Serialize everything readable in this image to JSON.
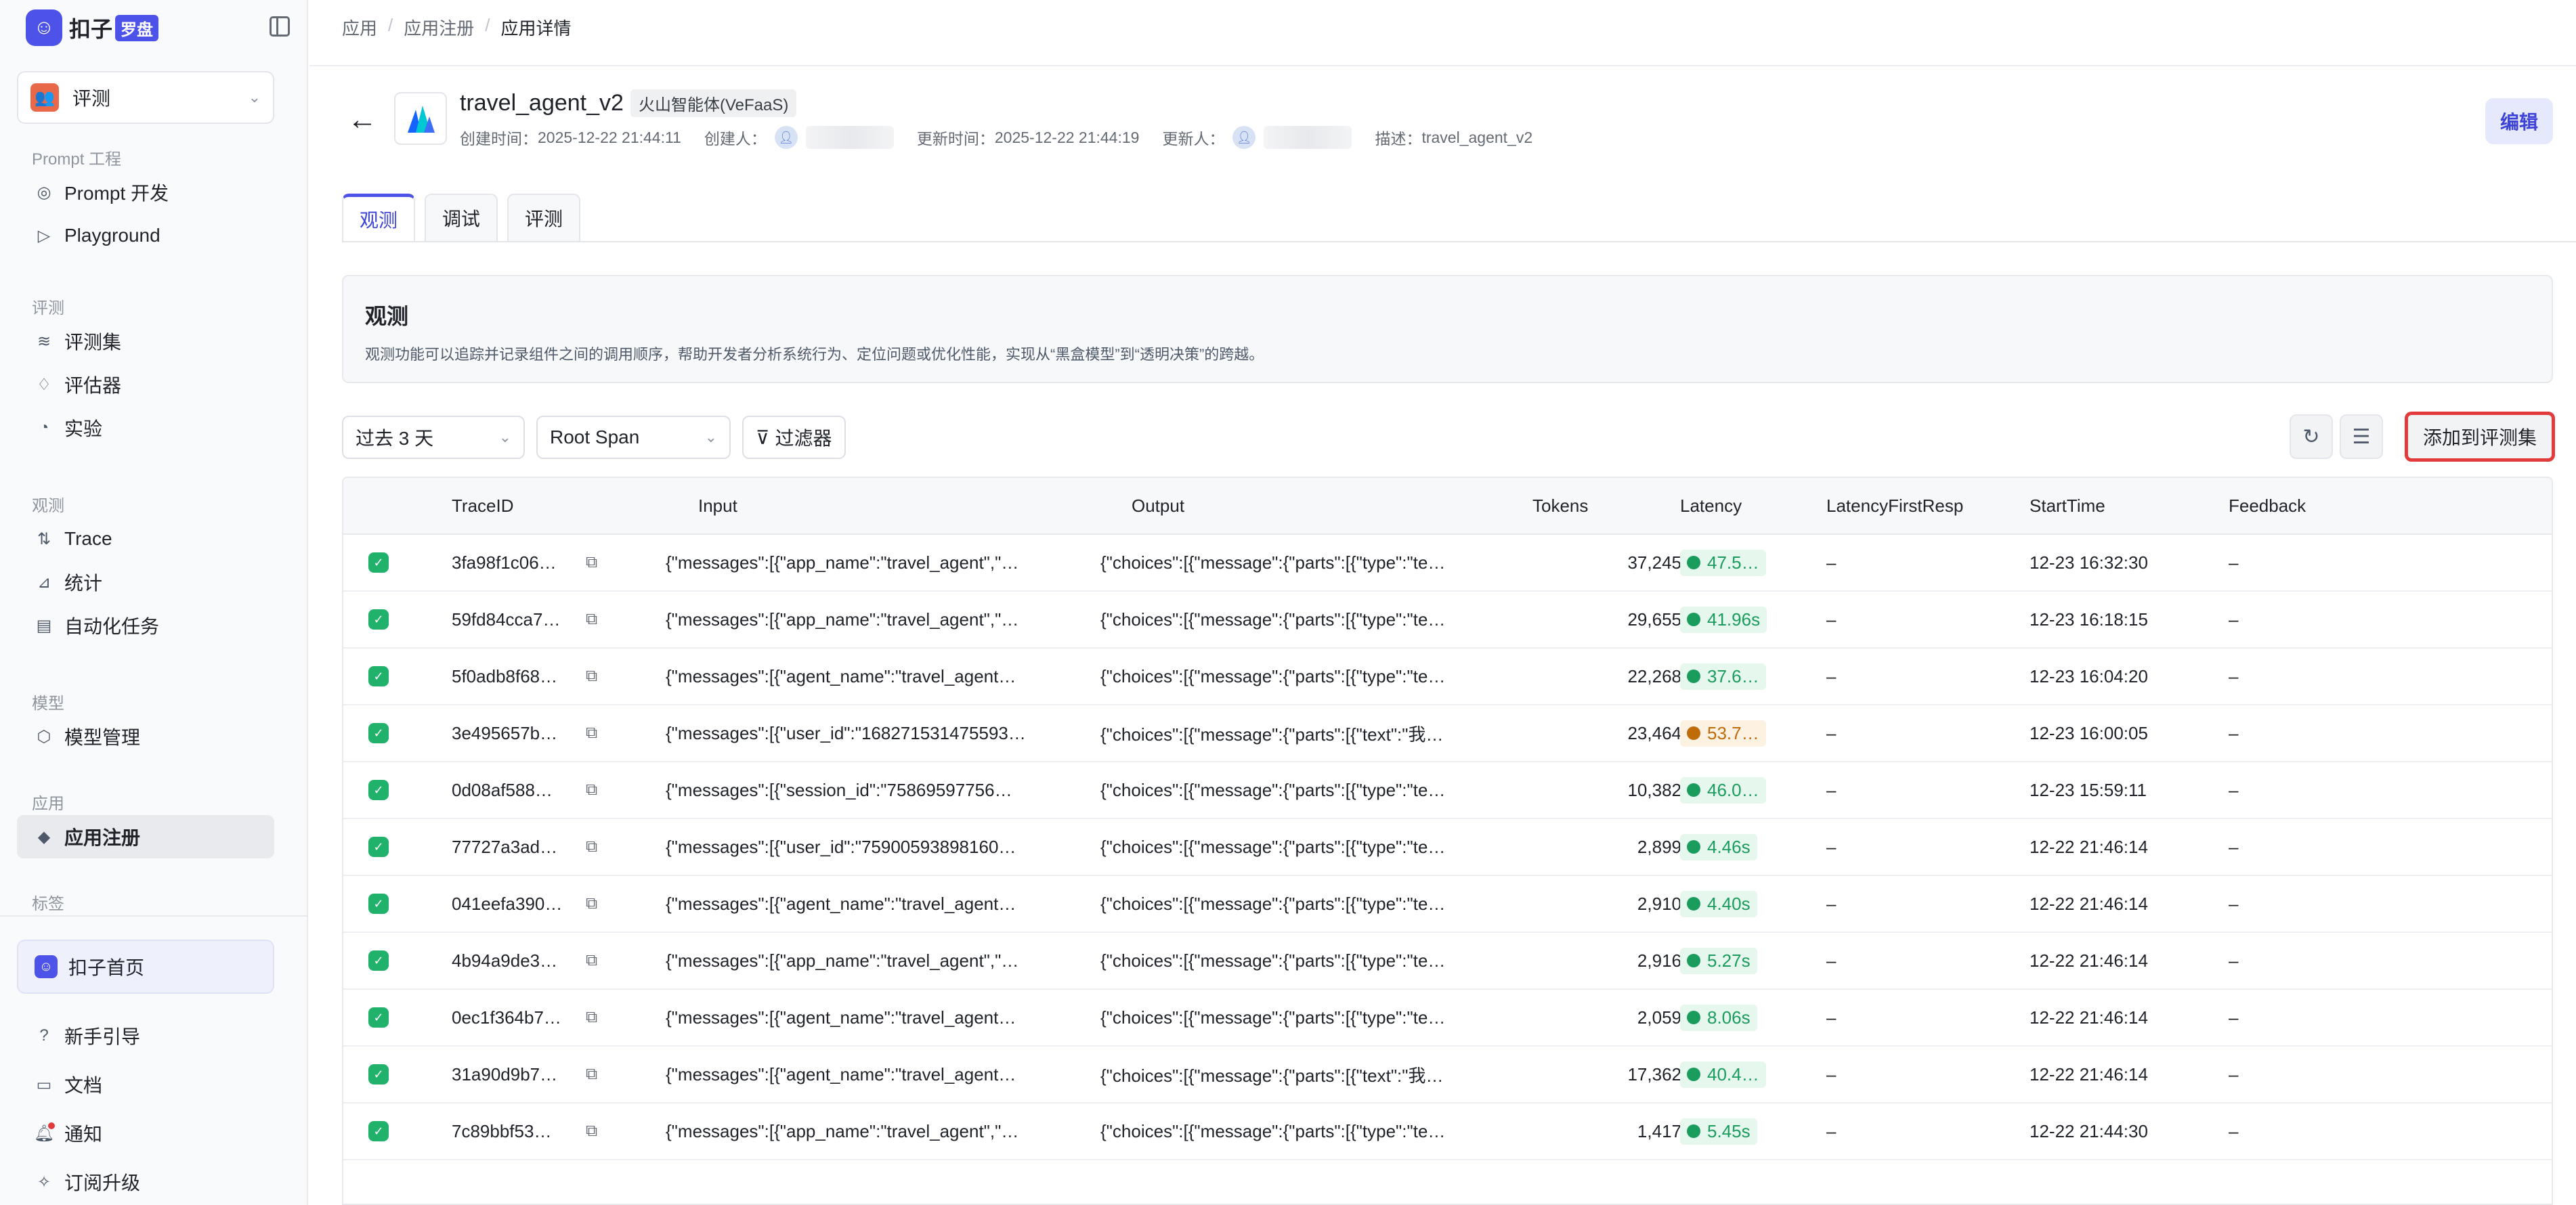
{
  "brand": {
    "name": "扣子",
    "badge": "罗盘"
  },
  "workspace": {
    "label": "评测"
  },
  "sidebar": {
    "sections": [
      {
        "title": "Prompt 工程",
        "items": [
          {
            "label": "Prompt 开发",
            "icon": "prompt-icon"
          },
          {
            "label": "Playground",
            "icon": "play-icon"
          }
        ]
      },
      {
        "title": "评测",
        "items": [
          {
            "label": "评测集",
            "icon": "database-icon"
          },
          {
            "label": "评估器",
            "icon": "evaluator-icon"
          },
          {
            "label": "实验",
            "icon": "experiment-icon"
          }
        ]
      },
      {
        "title": "观测",
        "items": [
          {
            "label": "Trace",
            "icon": "trace-icon"
          },
          {
            "label": "统计",
            "icon": "chart-icon"
          },
          {
            "label": "自动化任务",
            "icon": "task-icon"
          }
        ]
      },
      {
        "title": "模型",
        "items": [
          {
            "label": "模型管理",
            "icon": "model-icon"
          }
        ]
      },
      {
        "title": "应用",
        "items": [
          {
            "label": "应用注册",
            "icon": "app-icon",
            "active": true
          }
        ]
      },
      {
        "title": "标签",
        "items": []
      }
    ],
    "home": "扣子首页",
    "bottom": [
      {
        "label": "新手引导",
        "icon": "guide-icon"
      },
      {
        "label": "文档",
        "icon": "doc-icon"
      },
      {
        "label": "通知",
        "icon": "bell-icon"
      },
      {
        "label": "订阅升级",
        "icon": "upgrade-icon"
      }
    ]
  },
  "breadcrumb": [
    "应用",
    "应用注册",
    "应用详情"
  ],
  "app": {
    "name": "travel_agent_v2",
    "tag": "火山智能体(VeFaaS)",
    "created_label": "创建时间：",
    "created": "2025-12-22 21:44:11",
    "creator_label": "创建人：",
    "updated_label": "更新时间：",
    "updated": "2025-12-22 21:44:19",
    "updater_label": "更新人：",
    "desc_label": "描述：",
    "desc": "travel_agent_v2",
    "edit": "编辑"
  },
  "tabs": [
    "观测",
    "调试",
    "评测"
  ],
  "panel": {
    "title": "观测",
    "description": "观测功能可以追踪并记录组件之间的调用顺序，帮助开发者分析系统行为、定位问题或优化性能，实现从“黑盒模型”到“透明决策”的跨越。"
  },
  "toolbar": {
    "time_range": "过去 3 天",
    "span_type": "Root Span",
    "filter": "过滤器",
    "add_to_dataset": "添加到评测集"
  },
  "table": {
    "columns": [
      "TraceID",
      "Input",
      "Output",
      "Tokens",
      "Latency",
      "LatencyFirstResp",
      "StartTime",
      "Feedback"
    ],
    "rows": [
      {
        "id": "3fa98f1c06…",
        "input": "{\"messages\":[{\"app_name\":\"travel_agent\",\"…",
        "output": "{\"choices\":[{\"message\":{\"parts\":[{\"type\":\"te…",
        "tokens": "37,245",
        "latency": "47.5…",
        "lat_status": "ok",
        "first": "–",
        "start": "12-23 16:32:30",
        "feedback": "–"
      },
      {
        "id": "59fd84cca7…",
        "input": "{\"messages\":[{\"app_name\":\"travel_agent\",\"…",
        "output": "{\"choices\":[{\"message\":{\"parts\":[{\"type\":\"te…",
        "tokens": "29,655",
        "latency": "41.96s",
        "lat_status": "ok",
        "first": "–",
        "start": "12-23 16:18:15",
        "feedback": "–"
      },
      {
        "id": "5f0adb8f68…",
        "input": "{\"messages\":[{\"agent_name\":\"travel_agent…",
        "output": "{\"choices\":[{\"message\":{\"parts\":[{\"type\":\"te…",
        "tokens": "22,268",
        "latency": "37.6…",
        "lat_status": "ok",
        "first": "–",
        "start": "12-23 16:04:20",
        "feedback": "–"
      },
      {
        "id": "3e495657b…",
        "input": "{\"messages\":[{\"user_id\":\"168271531475593…",
        "output": "{\"choices\":[{\"message\":{\"parts\":[{\"text\":\"我…",
        "tokens": "23,464",
        "latency": "53.7…",
        "lat_status": "warn",
        "first": "–",
        "start": "12-23 16:00:05",
        "feedback": "–"
      },
      {
        "id": "0d08af588…",
        "input": "{\"messages\":[{\"session_id\":\"75869597756…",
        "output": "{\"choices\":[{\"message\":{\"parts\":[{\"type\":\"te…",
        "tokens": "10,382",
        "latency": "46.0…",
        "lat_status": "ok",
        "first": "–",
        "start": "12-23 15:59:11",
        "feedback": "–"
      },
      {
        "id": "77727a3ad…",
        "input": "{\"messages\":[{\"user_id\":\"75900593898160…",
        "output": "{\"choices\":[{\"message\":{\"parts\":[{\"type\":\"te…",
        "tokens": "2,899",
        "latency": "4.46s",
        "lat_status": "ok",
        "first": "–",
        "start": "12-22 21:46:14",
        "feedback": "–"
      },
      {
        "id": "041eefa390…",
        "input": "{\"messages\":[{\"agent_name\":\"travel_agent…",
        "output": "{\"choices\":[{\"message\":{\"parts\":[{\"type\":\"te…",
        "tokens": "2,910",
        "latency": "4.40s",
        "lat_status": "ok",
        "first": "–",
        "start": "12-22 21:46:14",
        "feedback": "–"
      },
      {
        "id": "4b94a9de3…",
        "input": "{\"messages\":[{\"app_name\":\"travel_agent\",\"…",
        "output": "{\"choices\":[{\"message\":{\"parts\":[{\"type\":\"te…",
        "tokens": "2,916",
        "latency": "5.27s",
        "lat_status": "ok",
        "first": "–",
        "start": "12-22 21:46:14",
        "feedback": "–"
      },
      {
        "id": "0ec1f364b7…",
        "input": "{\"messages\":[{\"agent_name\":\"travel_agent…",
        "output": "{\"choices\":[{\"message\":{\"parts\":[{\"type\":\"te…",
        "tokens": "2,059",
        "latency": "8.06s",
        "lat_status": "ok",
        "first": "–",
        "start": "12-22 21:46:14",
        "feedback": "–"
      },
      {
        "id": "31a90d9b7…",
        "input": "{\"messages\":[{\"agent_name\":\"travel_agent…",
        "output": "{\"choices\":[{\"message\":{\"parts\":[{\"text\":\"我…",
        "tokens": "17,362",
        "latency": "40.4…",
        "lat_status": "ok",
        "first": "–",
        "start": "12-22 21:46:14",
        "feedback": "–"
      },
      {
        "id": "7c89bbf53…",
        "input": "{\"messages\":[{\"app_name\":\"travel_agent\",\"…",
        "output": "{\"choices\":[{\"message\":{\"parts\":[{\"type\":\"te…",
        "tokens": "1,417",
        "latency": "5.45s",
        "lat_status": "ok",
        "first": "–",
        "start": "12-22 21:44:30",
        "feedback": "–"
      }
    ]
  },
  "colors": {
    "accent": "#4d53e8",
    "success": "#20b26b",
    "warning": "#c06b0a",
    "highlight_border": "#e23b3b"
  }
}
